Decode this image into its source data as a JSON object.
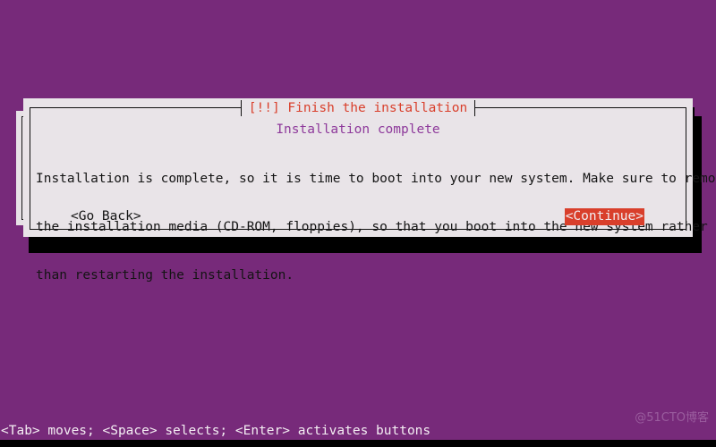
{
  "screen": {
    "background_color": "#772a7a",
    "shadow_color": "#000000"
  },
  "dialog": {
    "title": "[!!] Finish the installation",
    "title_color": "#d93f2b",
    "surface_color": "#e9e4e8",
    "border_color": "#111111",
    "heading": "Installation complete",
    "heading_color": "#8e3a9b",
    "paragraph_lines": [
      "Installation is complete, so it is time to boot into your new system. Make sure to remove",
      "the installation media (CD-ROM, floppies), so that you boot into the new system rather",
      "than restarting the installation."
    ],
    "buttons": [
      {
        "label": "<Go Back>",
        "name": "go-back-button",
        "selected": false,
        "text_color": "#141414",
        "background_color": "transparent"
      },
      {
        "label": "<Continue>",
        "name": "continue-button",
        "selected": true,
        "text_color": "#f2eef1",
        "background_color": "#d93f2b"
      }
    ]
  },
  "footer": {
    "help_text": "<Tab> moves; <Space> selects; <Enter> activates buttons",
    "text_color": "#f4eef3"
  },
  "watermark": {
    "text": "@51CTO博客",
    "color": "#9a5d9e"
  }
}
